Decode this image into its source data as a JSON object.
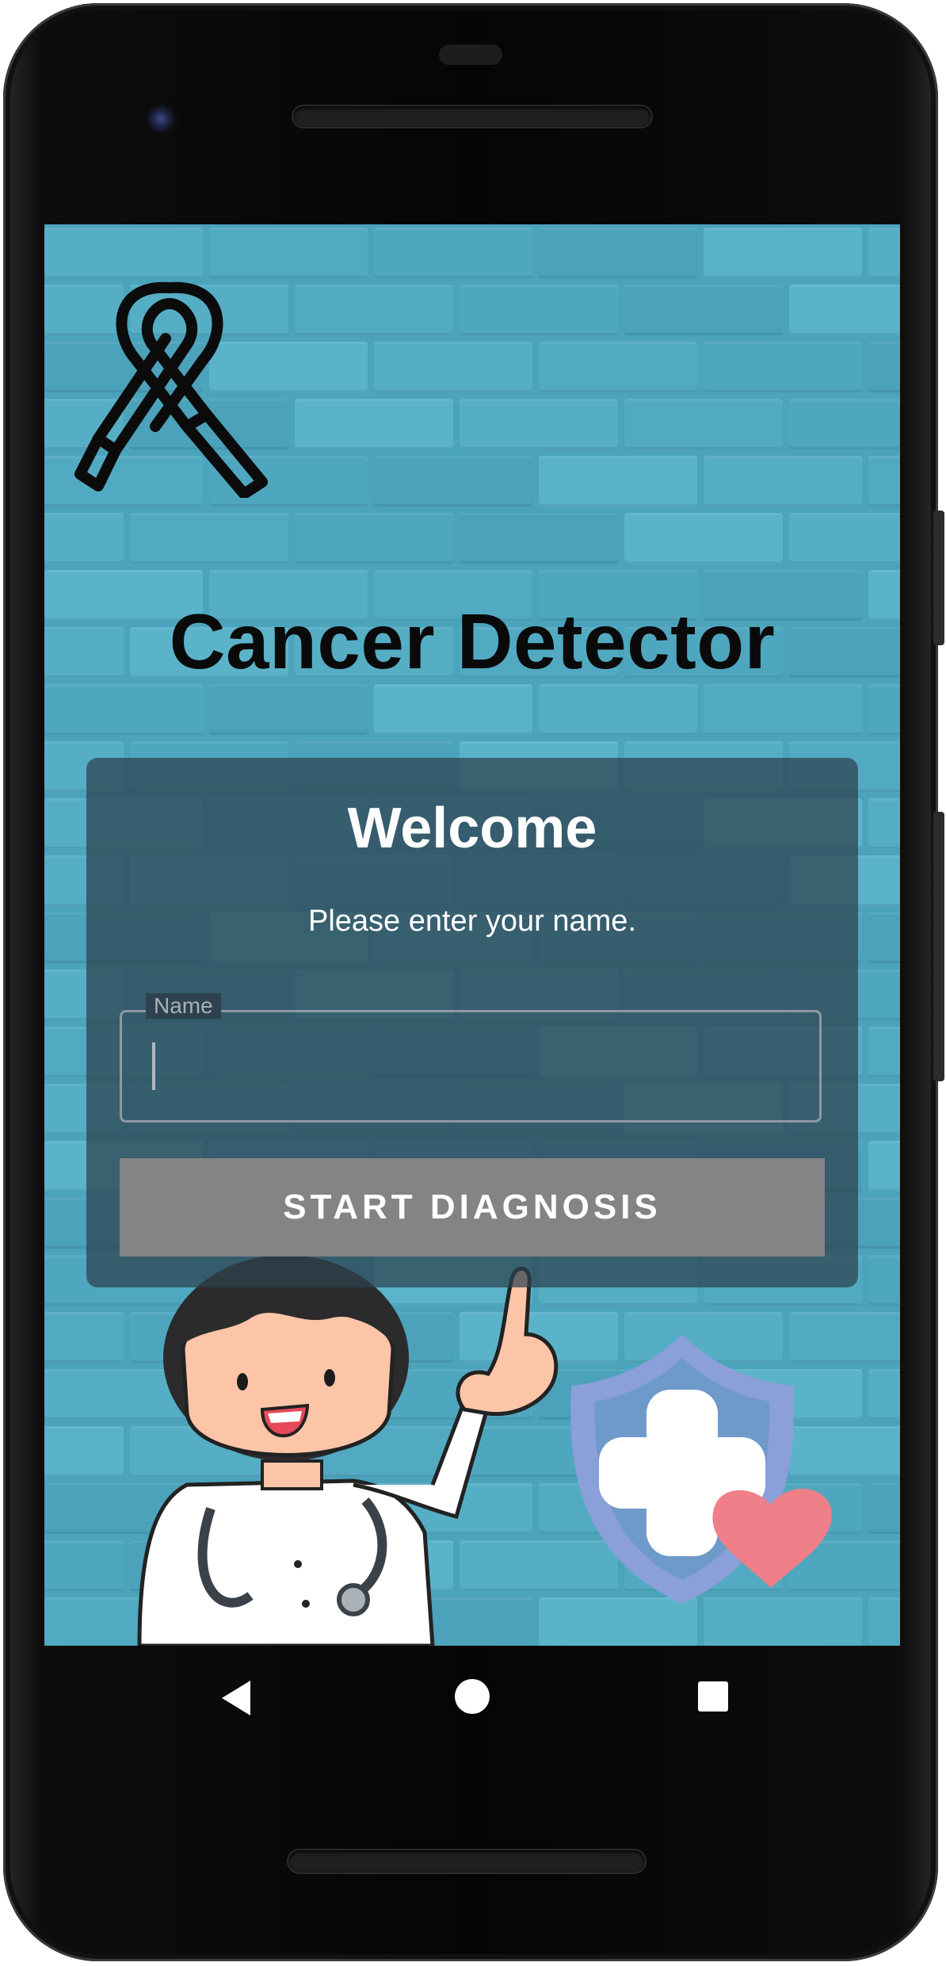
{
  "app": {
    "title": "Cancer Detector"
  },
  "welcome_card": {
    "heading": "Welcome",
    "prompt": "Please enter your name.",
    "name_field": {
      "label": "Name",
      "value": ""
    },
    "start_button_label": "START DIAGNOSIS"
  },
  "icons": {
    "logo": "cancer-ribbon-icon",
    "illustration_left": "doctor-pointing-illustration",
    "illustration_right": "medical-shield-heart-icon"
  },
  "navigation_bar": {
    "back": "back-triangle-icon",
    "home": "home-circle-icon",
    "recents": "recents-square-icon"
  },
  "colors": {
    "background": "#4ba3bc",
    "card": "#2d414e",
    "button": "#848484",
    "shield": "#8b9fd9",
    "heart": "#ef7f88"
  }
}
